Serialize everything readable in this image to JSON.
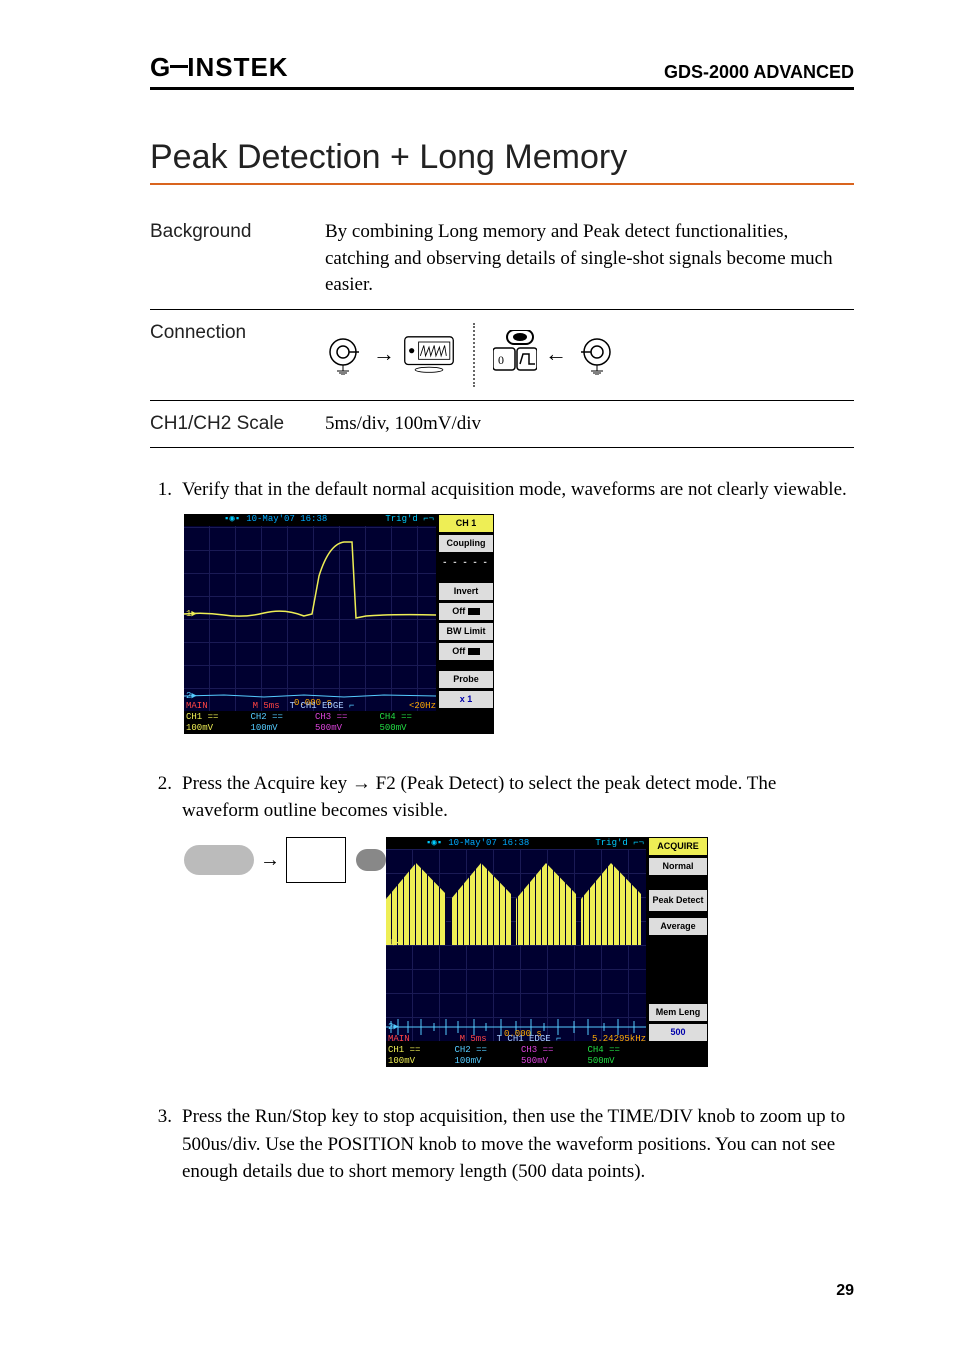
{
  "header": {
    "logo": "GWINSTEK",
    "doc_title": "GDS-2000 ADVANCED"
  },
  "section_title": "Peak Detection + Long Memory",
  "info": {
    "background_label": "Background",
    "background_text": "By combining Long memory and Peak detect functionalities, catching and observing details of single-shot signals become much easier.",
    "connection_label": "Connection",
    "scale_label": "CH1/CH2 Scale",
    "scale_value": "5ms/div, 100mV/div"
  },
  "steps": {
    "s1_num": "1.",
    "s1_text": "Verify that in the default normal acquisition mode, waveforms are not clearly viewable.",
    "s2_num": "2.",
    "s2_text": "Press the Acquire key → F2 (Peak Detect) to select the peak detect mode. The waveform outline becomes visible.",
    "s3_num": "3.",
    "s3_text": "Press the Run/Stop key to stop acquisition, then use the TIME/DIV knob to zoom up to 500us/div. Use the POSITION knob to move the waveform positions. You can not see enough details due to short memory length (500 data points)."
  },
  "scope1": {
    "date": "10-May'07 16:38",
    "trigd": "Trig'd",
    "menu_title": "CH 1",
    "btn_coupling": "Coupling",
    "btn_dash": "- - - - -",
    "btn_invert": "Invert",
    "btn_invert_off": "Off",
    "btn_bwlimit": "BW Limit",
    "btn_bwlimit_off": "Off",
    "btn_probe": "Probe",
    "btn_probe_val": "x 1",
    "time_label": "0.000 s",
    "main": "MAIN",
    "m5ms": "M 5ms",
    "trig": "T CH1 EDGE",
    "freq": "<20Hz",
    "ch1": "CH1 == 100mV",
    "ch2": "CH2 == 100mV",
    "ch3": "CH3 == 500mV",
    "ch4": "CH4 == 500mV"
  },
  "scope2": {
    "date": "10-May'07 16:38",
    "trigd": "Trig'd",
    "menu_title": "ACQUIRE",
    "btn_normal": "Normal",
    "btn_peak": "Peak Detect",
    "btn_average": "Average",
    "btn_memleng": "Mem Leng",
    "btn_memleng_val": "500",
    "time_label": "0.000 s",
    "main": "MAIN",
    "m5ms": "M 5ms",
    "trig": "T CH1 EDGE",
    "freq": "5.24295kHz",
    "ch1": "CH1 == 100mV",
    "ch2": "CH2 == 100mV",
    "ch3": "CH3 == 500mV",
    "ch4": "CH4 == 500mV"
  },
  "page_num": "29"
}
